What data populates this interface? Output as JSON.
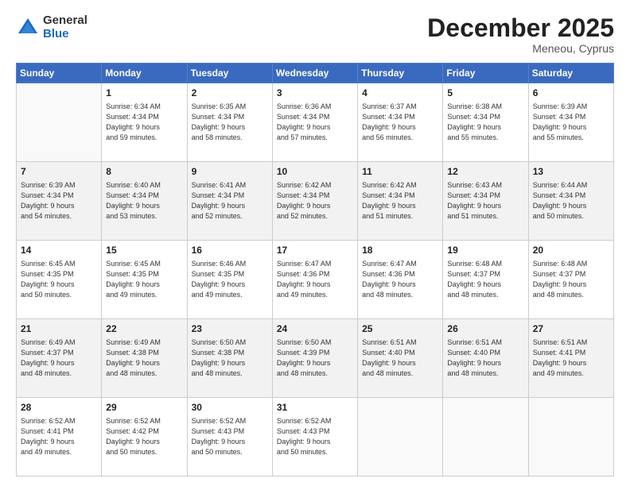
{
  "logo": {
    "general": "General",
    "blue": "Blue"
  },
  "header": {
    "month": "December 2025",
    "location": "Meneou, Cyprus"
  },
  "days_of_week": [
    "Sunday",
    "Monday",
    "Tuesday",
    "Wednesday",
    "Thursday",
    "Friday",
    "Saturday"
  ],
  "weeks": [
    {
      "shade": false,
      "days": [
        {
          "num": "",
          "info": ""
        },
        {
          "num": "1",
          "info": "Sunrise: 6:34 AM\nSunset: 4:34 PM\nDaylight: 9 hours\nand 59 minutes."
        },
        {
          "num": "2",
          "info": "Sunrise: 6:35 AM\nSunset: 4:34 PM\nDaylight: 9 hours\nand 58 minutes."
        },
        {
          "num": "3",
          "info": "Sunrise: 6:36 AM\nSunset: 4:34 PM\nDaylight: 9 hours\nand 57 minutes."
        },
        {
          "num": "4",
          "info": "Sunrise: 6:37 AM\nSunset: 4:34 PM\nDaylight: 9 hours\nand 56 minutes."
        },
        {
          "num": "5",
          "info": "Sunrise: 6:38 AM\nSunset: 4:34 PM\nDaylight: 9 hours\nand 55 minutes."
        },
        {
          "num": "6",
          "info": "Sunrise: 6:39 AM\nSunset: 4:34 PM\nDaylight: 9 hours\nand 55 minutes."
        }
      ]
    },
    {
      "shade": true,
      "days": [
        {
          "num": "7",
          "info": "Sunrise: 6:39 AM\nSunset: 4:34 PM\nDaylight: 9 hours\nand 54 minutes."
        },
        {
          "num": "8",
          "info": "Sunrise: 6:40 AM\nSunset: 4:34 PM\nDaylight: 9 hours\nand 53 minutes."
        },
        {
          "num": "9",
          "info": "Sunrise: 6:41 AM\nSunset: 4:34 PM\nDaylight: 9 hours\nand 52 minutes."
        },
        {
          "num": "10",
          "info": "Sunrise: 6:42 AM\nSunset: 4:34 PM\nDaylight: 9 hours\nand 52 minutes."
        },
        {
          "num": "11",
          "info": "Sunrise: 6:42 AM\nSunset: 4:34 PM\nDaylight: 9 hours\nand 51 minutes."
        },
        {
          "num": "12",
          "info": "Sunrise: 6:43 AM\nSunset: 4:34 PM\nDaylight: 9 hours\nand 51 minutes."
        },
        {
          "num": "13",
          "info": "Sunrise: 6:44 AM\nSunset: 4:34 PM\nDaylight: 9 hours\nand 50 minutes."
        }
      ]
    },
    {
      "shade": false,
      "days": [
        {
          "num": "14",
          "info": "Sunrise: 6:45 AM\nSunset: 4:35 PM\nDaylight: 9 hours\nand 50 minutes."
        },
        {
          "num": "15",
          "info": "Sunrise: 6:45 AM\nSunset: 4:35 PM\nDaylight: 9 hours\nand 49 minutes."
        },
        {
          "num": "16",
          "info": "Sunrise: 6:46 AM\nSunset: 4:35 PM\nDaylight: 9 hours\nand 49 minutes."
        },
        {
          "num": "17",
          "info": "Sunrise: 6:47 AM\nSunset: 4:36 PM\nDaylight: 9 hours\nand 49 minutes."
        },
        {
          "num": "18",
          "info": "Sunrise: 6:47 AM\nSunset: 4:36 PM\nDaylight: 9 hours\nand 48 minutes."
        },
        {
          "num": "19",
          "info": "Sunrise: 6:48 AM\nSunset: 4:37 PM\nDaylight: 9 hours\nand 48 minutes."
        },
        {
          "num": "20",
          "info": "Sunrise: 6:48 AM\nSunset: 4:37 PM\nDaylight: 9 hours\nand 48 minutes."
        }
      ]
    },
    {
      "shade": true,
      "days": [
        {
          "num": "21",
          "info": "Sunrise: 6:49 AM\nSunset: 4:37 PM\nDaylight: 9 hours\nand 48 minutes."
        },
        {
          "num": "22",
          "info": "Sunrise: 6:49 AM\nSunset: 4:38 PM\nDaylight: 9 hours\nand 48 minutes."
        },
        {
          "num": "23",
          "info": "Sunrise: 6:50 AM\nSunset: 4:38 PM\nDaylight: 9 hours\nand 48 minutes."
        },
        {
          "num": "24",
          "info": "Sunrise: 6:50 AM\nSunset: 4:39 PM\nDaylight: 9 hours\nand 48 minutes."
        },
        {
          "num": "25",
          "info": "Sunrise: 6:51 AM\nSunset: 4:40 PM\nDaylight: 9 hours\nand 48 minutes."
        },
        {
          "num": "26",
          "info": "Sunrise: 6:51 AM\nSunset: 4:40 PM\nDaylight: 9 hours\nand 48 minutes."
        },
        {
          "num": "27",
          "info": "Sunrise: 6:51 AM\nSunset: 4:41 PM\nDaylight: 9 hours\nand 49 minutes."
        }
      ]
    },
    {
      "shade": false,
      "days": [
        {
          "num": "28",
          "info": "Sunrise: 6:52 AM\nSunset: 4:41 PM\nDaylight: 9 hours\nand 49 minutes."
        },
        {
          "num": "29",
          "info": "Sunrise: 6:52 AM\nSunset: 4:42 PM\nDaylight: 9 hours\nand 50 minutes."
        },
        {
          "num": "30",
          "info": "Sunrise: 6:52 AM\nSunset: 4:43 PM\nDaylight: 9 hours\nand 50 minutes."
        },
        {
          "num": "31",
          "info": "Sunrise: 6:52 AM\nSunset: 4:43 PM\nDaylight: 9 hours\nand 50 minutes."
        },
        {
          "num": "",
          "info": ""
        },
        {
          "num": "",
          "info": ""
        },
        {
          "num": "",
          "info": ""
        }
      ]
    }
  ]
}
